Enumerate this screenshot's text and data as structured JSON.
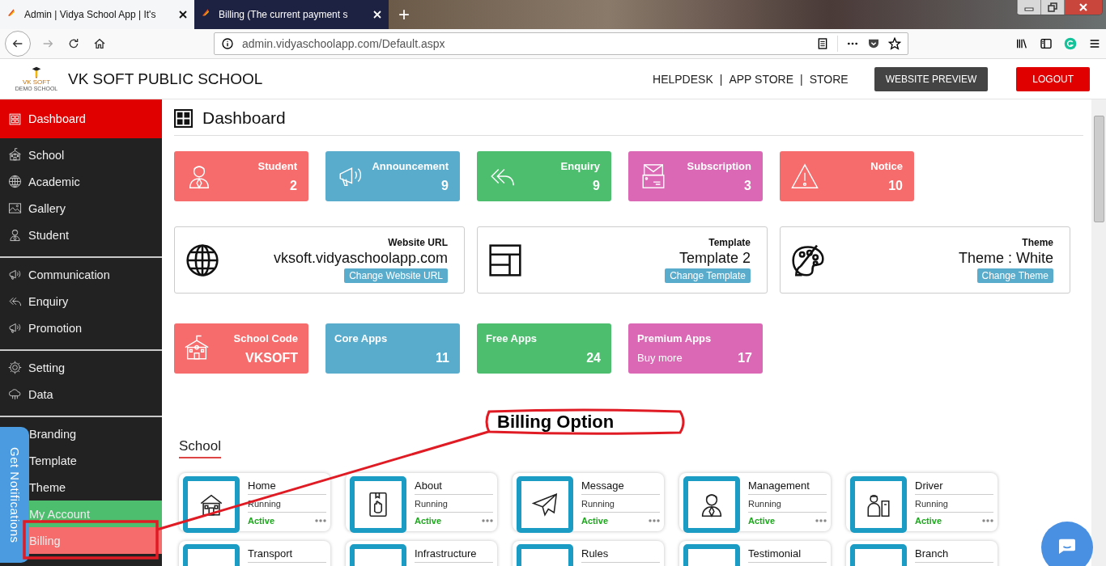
{
  "browser": {
    "tabs": [
      {
        "title": "Admin | Vidya School App | It's",
        "selected": true
      },
      {
        "title": "Billing (The current payment s",
        "selected": false
      }
    ],
    "new_tab": "+",
    "url": "admin.vidyaschoolapp.com/Default.aspx",
    "forward_disabled": true
  },
  "header": {
    "logo_caption": "VK SOFT",
    "logo_subcaption": "DEMO SCHOOL",
    "school_name": "VK SOFT PUBLIC SCHOOL",
    "links": [
      "HELPDESK",
      "APP STORE",
      "STORE"
    ],
    "separator": "|",
    "preview_button": "WEBSITE PREVIEW",
    "logout_button": "LOGOUT"
  },
  "sidebar": {
    "groups": [
      [
        {
          "label": "Dashboard",
          "kind": "grid",
          "selected": true
        }
      ],
      [
        {
          "label": "School",
          "kind": "building",
          "selected": false
        },
        {
          "label": "Academic",
          "kind": "globe",
          "selected": false
        },
        {
          "label": "Gallery",
          "kind": "image",
          "selected": false
        },
        {
          "label": "Student",
          "kind": "person",
          "selected": false
        }
      ],
      [
        {
          "label": "Communication",
          "kind": "megaphone",
          "selected": false
        },
        {
          "label": "Enquiry",
          "kind": "reply",
          "selected": false
        },
        {
          "label": "Promotion",
          "kind": "megaphone",
          "selected": false
        }
      ],
      [
        {
          "label": "Setting",
          "kind": "gear",
          "selected": false
        },
        {
          "label": "Data",
          "kind": "cloud",
          "selected": false
        }
      ],
      [
        {
          "label": "Branding",
          "selected": false
        },
        {
          "label": "Template",
          "selected": false
        },
        {
          "label": "Theme",
          "selected": false
        },
        {
          "label": "My Account",
          "selected": false,
          "color": "#4cbe6e"
        },
        {
          "label": "Billing",
          "selected": false,
          "color": "#f66c6c"
        }
      ]
    ]
  },
  "notifications_tab": "Get Notifications",
  "page_title": "Dashboard",
  "stats": [
    {
      "label": "Student",
      "value": "2",
      "color": "#f66c6c",
      "kind": "person"
    },
    {
      "label": "Announcement",
      "value": "9",
      "color": "#5aaccd",
      "kind": "megaphone"
    },
    {
      "label": "Enquiry",
      "value": "9",
      "color": "#4cbe6e",
      "kind": "reply"
    },
    {
      "label": "Subscription",
      "value": "3",
      "color": "#db68b4",
      "kind": "envelope"
    },
    {
      "label": "Notice",
      "value": "10",
      "color": "#f66c6c",
      "kind": "warning"
    }
  ],
  "info_cards": [
    {
      "label": "Website URL",
      "value": "vksoft.vidyaschoolapp.com",
      "button": "Change Website URL",
      "kind": "globe"
    },
    {
      "label": "Template",
      "value": "Template 2",
      "button": "Change Template",
      "kind": "layout"
    },
    {
      "label": "Theme",
      "value": "Theme : White",
      "button": "Change Theme",
      "kind": "palette"
    }
  ],
  "summary_cards": [
    {
      "label": "School Code",
      "value": "VKSOFT",
      "color": "#f66c6c",
      "kind": "building"
    },
    {
      "label": "Core Apps",
      "value": "11",
      "color": "#5aaccd"
    },
    {
      "label": "Free Apps",
      "value": "24",
      "color": "#4cbe6e"
    },
    {
      "label": "Premium Apps",
      "note": "Buy more",
      "value": "17",
      "color": "#db68b4"
    }
  ],
  "annotation": {
    "label": "Billing Option"
  },
  "section": {
    "title": "School",
    "apps": [
      {
        "name": "Home",
        "status": "Running",
        "state": "Active",
        "kind": "house"
      },
      {
        "name": "About",
        "status": "Running",
        "state": "Active",
        "kind": "book"
      },
      {
        "name": "Message",
        "status": "Running",
        "state": "Active",
        "kind": "plane"
      },
      {
        "name": "Management",
        "status": "Running",
        "state": "Active",
        "kind": "person"
      },
      {
        "name": "Driver",
        "status": "Running",
        "state": "Active",
        "kind": "driver"
      },
      {
        "name": "Transport"
      },
      {
        "name": "Infrastructure"
      },
      {
        "name": "Rules"
      },
      {
        "name": "Testimonial"
      },
      {
        "name": "Branch"
      }
    ]
  }
}
